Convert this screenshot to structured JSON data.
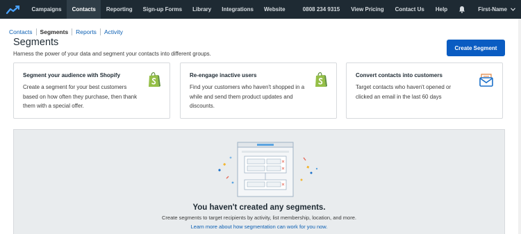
{
  "nav": {
    "items": [
      "Campaigns",
      "Contacts",
      "Reporting",
      "Sign-up Forms",
      "Library",
      "Integrations",
      "Website"
    ],
    "active": "Contacts",
    "phone": "0808 234 9315",
    "view_pricing": "View Pricing",
    "contact_us": "Contact Us",
    "help": "Help",
    "user_name": "First-Name"
  },
  "subnav": {
    "contacts": "Contacts",
    "segments": "Segments",
    "reports": "Reports",
    "activity": "Activity"
  },
  "page": {
    "title": "Segments",
    "subtitle": "Harness the power of your data and segment your contacts into different groups.",
    "create_button": "Create Segment"
  },
  "cards": [
    {
      "title": "Segment your audience with Shopify",
      "desc": "Create a segment for your best customers based on how often they purchase, then thank them with a special offer.",
      "icon": "shopify-icon"
    },
    {
      "title": "Re-engage inactive users",
      "desc": "Find your customers who haven't shopped in a while and send them product updates and discounts.",
      "icon": "shopify-icon"
    },
    {
      "title": "Convert contacts into customers",
      "desc": "Target contacts who haven't opened or clicked an email in the last 60 days",
      "icon": "envelope-icon"
    }
  ],
  "empty_state": {
    "title": "You haven't created any segments.",
    "subtitle": "Create segments to target recipients by activity, list membership, location, and more.",
    "link": "Learn more about how segmentation can work for you now."
  },
  "colors": {
    "nav_bg": "#1e2a33",
    "primary": "#0a5cc2",
    "link": "#0b5fb3",
    "shopify_green": "#95bf47"
  }
}
